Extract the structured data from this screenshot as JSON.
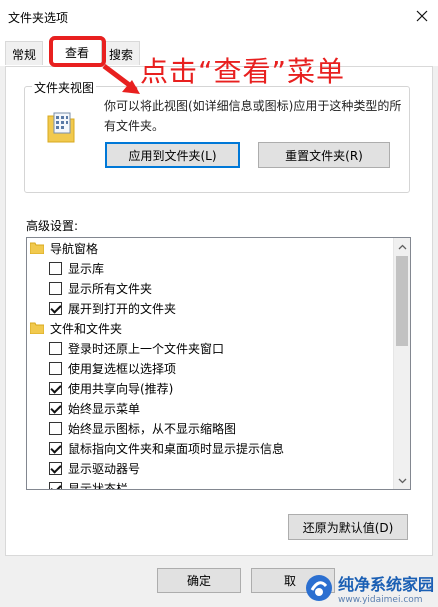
{
  "window": {
    "title": "文件夹选项"
  },
  "tabs": [
    {
      "label": "常规"
    },
    {
      "label": "查看"
    },
    {
      "label": "搜索"
    }
  ],
  "annotation": {
    "text": "点击“查看”菜单"
  },
  "folder_view": {
    "group_label": "文件夹视图",
    "description": "你可以将此视图(如详细信息或图标)应用于这种类型的所有文件夹。",
    "apply_button": "应用到文件夹(L)",
    "reset_button": "重置文件夹(R)"
  },
  "advanced": {
    "label": "高级设置:",
    "items": [
      {
        "label": "导航窗格",
        "kind": "folder"
      },
      {
        "label": "显示库",
        "kind": "check",
        "checked": false
      },
      {
        "label": "显示所有文件夹",
        "kind": "check",
        "checked": false
      },
      {
        "label": "展开到打开的文件夹",
        "kind": "check",
        "checked": true
      },
      {
        "label": "文件和文件夹",
        "kind": "folder"
      },
      {
        "label": "登录时还原上一个文件夹窗口",
        "kind": "check",
        "checked": false
      },
      {
        "label": "使用复选框以选择项",
        "kind": "check",
        "checked": false
      },
      {
        "label": "使用共享向导(推荐)",
        "kind": "check",
        "checked": true
      },
      {
        "label": "始终显示菜单",
        "kind": "check",
        "checked": true
      },
      {
        "label": "始终显示图标，从不显示缩略图",
        "kind": "check",
        "checked": false
      },
      {
        "label": "鼠标指向文件夹和桌面项时显示提示信息",
        "kind": "check",
        "checked": true
      },
      {
        "label": "显示驱动器号",
        "kind": "check",
        "checked": true
      },
      {
        "label": "显示状态栏",
        "kind": "check",
        "checked": true
      }
    ],
    "restore_button": "还原为默认值(D)"
  },
  "footer": {
    "ok_button": "确定",
    "cancel_button": "取"
  },
  "watermark": {
    "title": "纯净系统家园",
    "url": "www.yidaimei.com"
  },
  "colors": {
    "annotation": "#e8201f",
    "focus": "#0078d7"
  }
}
